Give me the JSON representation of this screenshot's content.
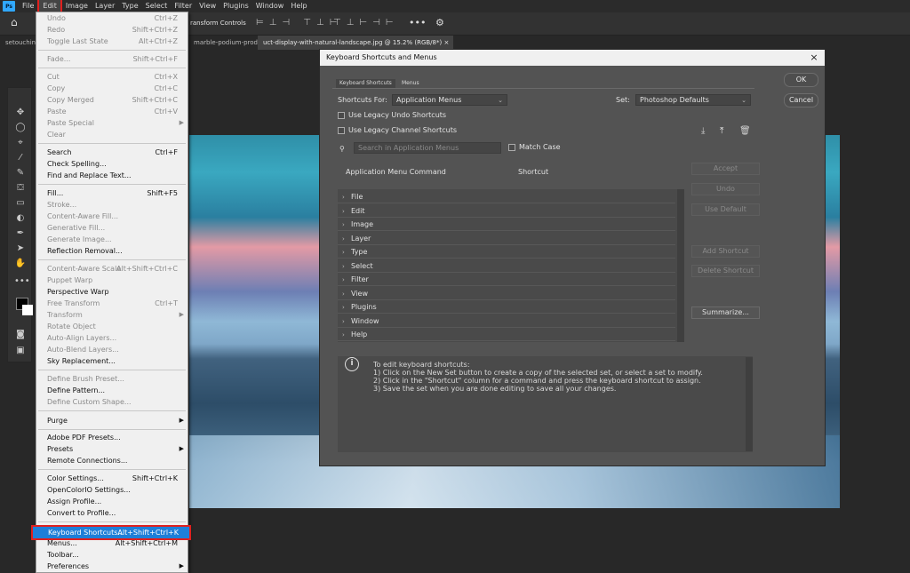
{
  "menubar": {
    "logo": "Ps",
    "items": [
      "File",
      "Edit",
      "Image",
      "Layer",
      "Type",
      "Select",
      "Filter",
      "View",
      "Plugins",
      "Window",
      "Help"
    ]
  },
  "optbar": {
    "transform_controls": "ransform Controls"
  },
  "tabs": [
    {
      "label": "setouchin"
    },
    {
      "label": "marble-podium-produ"
    },
    {
      "label": "uct-display-with-natural-landscape.jpg @ 15.2% (RGB/8*)",
      "close": "×"
    }
  ],
  "edit_menu": {
    "items": [
      {
        "label": "Undo",
        "shortcut": "Ctrl+Z",
        "disabled": true
      },
      {
        "label": "Redo",
        "shortcut": "Shift+Ctrl+Z",
        "disabled": true
      },
      {
        "label": "Toggle Last State",
        "shortcut": "Alt+Ctrl+Z",
        "disabled": true
      },
      {
        "label": "Fade...",
        "shortcut": "Shift+Ctrl+F",
        "disabled": true
      },
      {
        "label": "Cut",
        "shortcut": "Ctrl+X",
        "disabled": true
      },
      {
        "label": "Copy",
        "shortcut": "Ctrl+C",
        "disabled": true
      },
      {
        "label": "Copy Merged",
        "shortcut": "Shift+Ctrl+C",
        "disabled": true
      },
      {
        "label": "Paste",
        "shortcut": "Ctrl+V",
        "disabled": true
      },
      {
        "label": "Paste Special",
        "shortcut": "",
        "disabled": true,
        "submenu": true
      },
      {
        "label": "Clear",
        "shortcut": "",
        "disabled": true
      },
      {
        "label": "Search",
        "shortcut": "Ctrl+F",
        "disabled": false
      },
      {
        "label": "Check Spelling...",
        "shortcut": "",
        "disabled": false
      },
      {
        "label": "Find and Replace Text...",
        "shortcut": "",
        "disabled": false
      },
      {
        "label": "Fill...",
        "shortcut": "Shift+F5",
        "disabled": false
      },
      {
        "label": "Stroke...",
        "shortcut": "",
        "disabled": true
      },
      {
        "label": "Content-Aware Fill...",
        "shortcut": "",
        "disabled": true
      },
      {
        "label": "Generative Fill...",
        "shortcut": "",
        "disabled": true
      },
      {
        "label": "Generate Image...",
        "shortcut": "",
        "disabled": true
      },
      {
        "label": "Reflection Removal...",
        "shortcut": "",
        "disabled": false
      },
      {
        "label": "Content-Aware Scale",
        "shortcut": "Alt+Shift+Ctrl+C",
        "disabled": true
      },
      {
        "label": "Puppet Warp",
        "shortcut": "",
        "disabled": true
      },
      {
        "label": "Perspective Warp",
        "shortcut": "",
        "disabled": false
      },
      {
        "label": "Free Transform",
        "shortcut": "Ctrl+T",
        "disabled": true
      },
      {
        "label": "Transform",
        "shortcut": "",
        "disabled": true,
        "submenu": true
      },
      {
        "label": "Rotate Object",
        "shortcut": "",
        "disabled": true
      },
      {
        "label": "Auto-Align Layers...",
        "shortcut": "",
        "disabled": true
      },
      {
        "label": "Auto-Blend Layers...",
        "shortcut": "",
        "disabled": true
      },
      {
        "label": "Sky Replacement...",
        "shortcut": "",
        "disabled": false
      },
      {
        "label": "Define Brush Preset...",
        "shortcut": "",
        "disabled": true
      },
      {
        "label": "Define Pattern...",
        "shortcut": "",
        "disabled": false
      },
      {
        "label": "Define Custom Shape...",
        "shortcut": "",
        "disabled": true
      },
      {
        "label": "Purge",
        "shortcut": "",
        "disabled": false,
        "submenu": true
      },
      {
        "label": "Adobe PDF Presets...",
        "shortcut": "",
        "disabled": false
      },
      {
        "label": "Presets",
        "shortcut": "",
        "disabled": false,
        "submenu": true
      },
      {
        "label": "Remote Connections...",
        "shortcut": "",
        "disabled": false
      },
      {
        "label": "Color Settings...",
        "shortcut": "Shift+Ctrl+K",
        "disabled": false
      },
      {
        "label": "OpenColorIO Settings...",
        "shortcut": "",
        "disabled": false
      },
      {
        "label": "Assign Profile...",
        "shortcut": "",
        "disabled": false
      },
      {
        "label": "Convert to Profile...",
        "shortcut": "",
        "disabled": false
      },
      {
        "label": "Keyboard Shortcuts...",
        "shortcut": "Alt+Shift+Ctrl+K",
        "disabled": false,
        "highlighted": true
      },
      {
        "label": "Menus...",
        "shortcut": "Alt+Shift+Ctrl+M",
        "disabled": false
      },
      {
        "label": "Toolbar...",
        "shortcut": "",
        "disabled": false
      },
      {
        "label": "Preferences",
        "shortcut": "",
        "disabled": false,
        "submenu": true
      }
    ]
  },
  "dialog": {
    "title": "Keyboard Shortcuts and Menus",
    "close": "×",
    "tabs": [
      "Keyboard Shortcuts",
      "Menus"
    ],
    "shortcuts_for_label": "Shortcuts For:",
    "shortcuts_for_value": "Application Menus",
    "set_label": "Set:",
    "set_value": "Photoshop Defaults",
    "legacy_undo": "Use Legacy Undo Shortcuts",
    "legacy_channel": "Use Legacy Channel Shortcuts",
    "search_placeholder": "Search in Application Menus",
    "match_case": "Match Case",
    "col_command": "Application Menu Command",
    "col_shortcut": "Shortcut",
    "rows": [
      "File",
      "Edit",
      "Image",
      "Layer",
      "Type",
      "Select",
      "Filter",
      "View",
      "Plugins",
      "Window",
      "Help"
    ],
    "side_buttons": {
      "accept": "Accept",
      "undo": "Undo",
      "use_default": "Use Default",
      "add_shortcut": "Add Shortcut",
      "delete_shortcut": "Delete Shortcut",
      "summarize": "Summarize..."
    },
    "ok": "OK",
    "cancel": "Cancel",
    "info_icon": "i",
    "info_text": "To edit keyboard shortcuts:\n1) Click on the New Set button to create a copy of the selected set, or select a set to modify.\n2) Click in the \"Shortcut\" column for a command and press the keyboard shortcut to assign.\n3) Save the set when you are done editing to save all your changes."
  },
  "colors": {
    "highlight": "#1e7fd8",
    "annotation_red": "#e0201e",
    "dialog_bg": "#535353"
  }
}
